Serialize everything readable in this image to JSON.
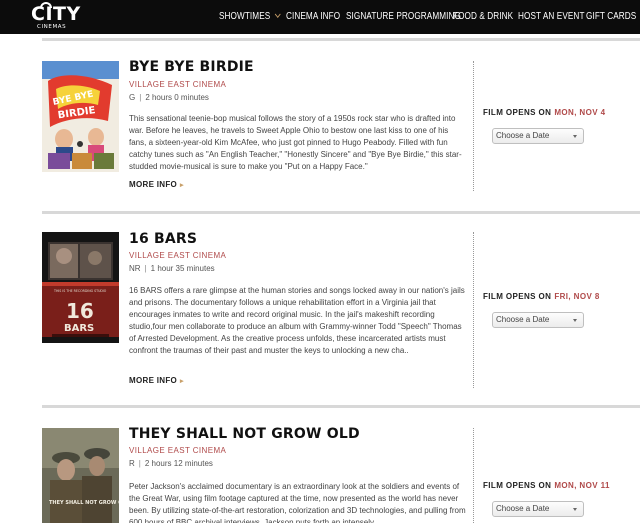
{
  "logo": {
    "main": "CITY",
    "sub": "CINEMAS"
  },
  "nav": {
    "showtimes": "SHOWTIMES",
    "cinema_info": "CINEMA INFO",
    "signature": "SIGNATURE PROGRAMMING",
    "food": "FOOD & DRINK",
    "host": "HOST AN EVENT",
    "gift": "GIFT CARDS"
  },
  "films": [
    {
      "title": "BYE BYE BIRDIE",
      "venue": "VILLAGE EAST CINEMA",
      "rating": "G",
      "runtime": "2 hours 0 minutes",
      "description": "This sensational teenie-bop musical follows the story of a 1950s rock star who is drafted into war. Before he leaves, he travels to Sweet Apple Ohio to bestow one last kiss to one of his fans, a sixteen-year-old Kim McAfee, who just got pinned to Hugo Peabody. Filled with fun catchy tunes such as \"An English Teacher,\" \"Honestly Sincere\" and \"Bye Bye Birdie,\" this star-studded movie-musical is sure to make you \"Put on a Happy Face.\"",
      "more": "MORE INFO",
      "opens_label": "FILM OPENS ON",
      "opens_date": "MON, NOV 4",
      "select_placeholder": "Choose a Date"
    },
    {
      "title": "16 BARS",
      "venue": "VILLAGE EAST CINEMA",
      "rating": "NR",
      "runtime": "1 hour 35 minutes",
      "description": "16 BARS offers a rare glimpse at the human stories and songs locked away in our nation's jails and prisons. The documentary follows a unique rehabilitation effort in a Virginia jail that encourages inmates to write and record original music. In the jail's makeshift recording studio,four men collaborate to produce an album with Grammy-winner Todd \"Speech\" Thomas of Arrested Development. As the creative process unfolds, these incarcerated artists must confront the traumas of their past and muster the keys to unlocking a new cha..",
      "more": "MORE INFO",
      "opens_label": "FILM OPENS ON",
      "opens_date": "FRI, NOV 8",
      "select_placeholder": "Choose a Date"
    },
    {
      "title": "THEY SHALL NOT GROW OLD",
      "venue": "VILLAGE EAST CINEMA",
      "rating": "R",
      "runtime": "2 hours 12 minutes",
      "description": "Peter Jackson's acclaimed documentary is an extraordinary look at the soldiers and events of the Great War, using film footage captured at the time, now presented as the world has never been. By utilizing state-of-the-art restoration, colorization and 3D technologies, and pulling from 600 hours of BBC archival interviews, Jackson puts forth an intensely",
      "more": "MORE INFO",
      "opens_label": "FILM OPENS ON",
      "opens_date": "MON, NOV 11",
      "select_placeholder": "Choose a Date"
    }
  ],
  "posters": {
    "0": {
      "title_art": "BYE BYE BIRDIE"
    },
    "1": {
      "title_art": "16 BARS",
      "tagline": "THIS IS THE RECORDING STUDIO"
    },
    "2": {
      "title_art": "THEY SHALL NOT GROW OLD"
    }
  },
  "colors": {
    "topbar": "#0c0c0c",
    "venue": "#b04a4a",
    "accent_arrow": "#c9a16b"
  }
}
